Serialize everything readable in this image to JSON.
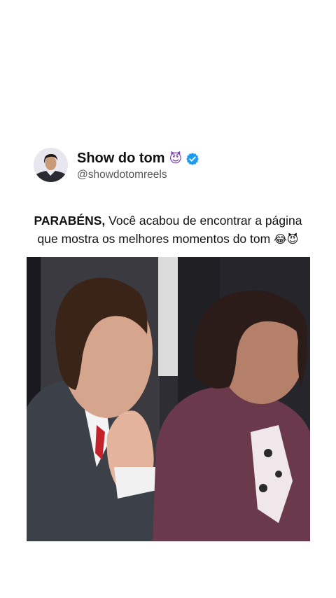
{
  "profile": {
    "display_name": "Show do tom",
    "name_emoji": "😈",
    "handle": "@showdotomreels",
    "verified": true
  },
  "caption": {
    "bold_text": "PARABÉNS,",
    "line1_rest": " Você acabou de encontrar a página",
    "line2": "que mostra os melhores momentos do tom ",
    "emojis": "😂😈"
  },
  "colors": {
    "verified_badge": "#1d9bf0",
    "background": "#ffffff"
  }
}
